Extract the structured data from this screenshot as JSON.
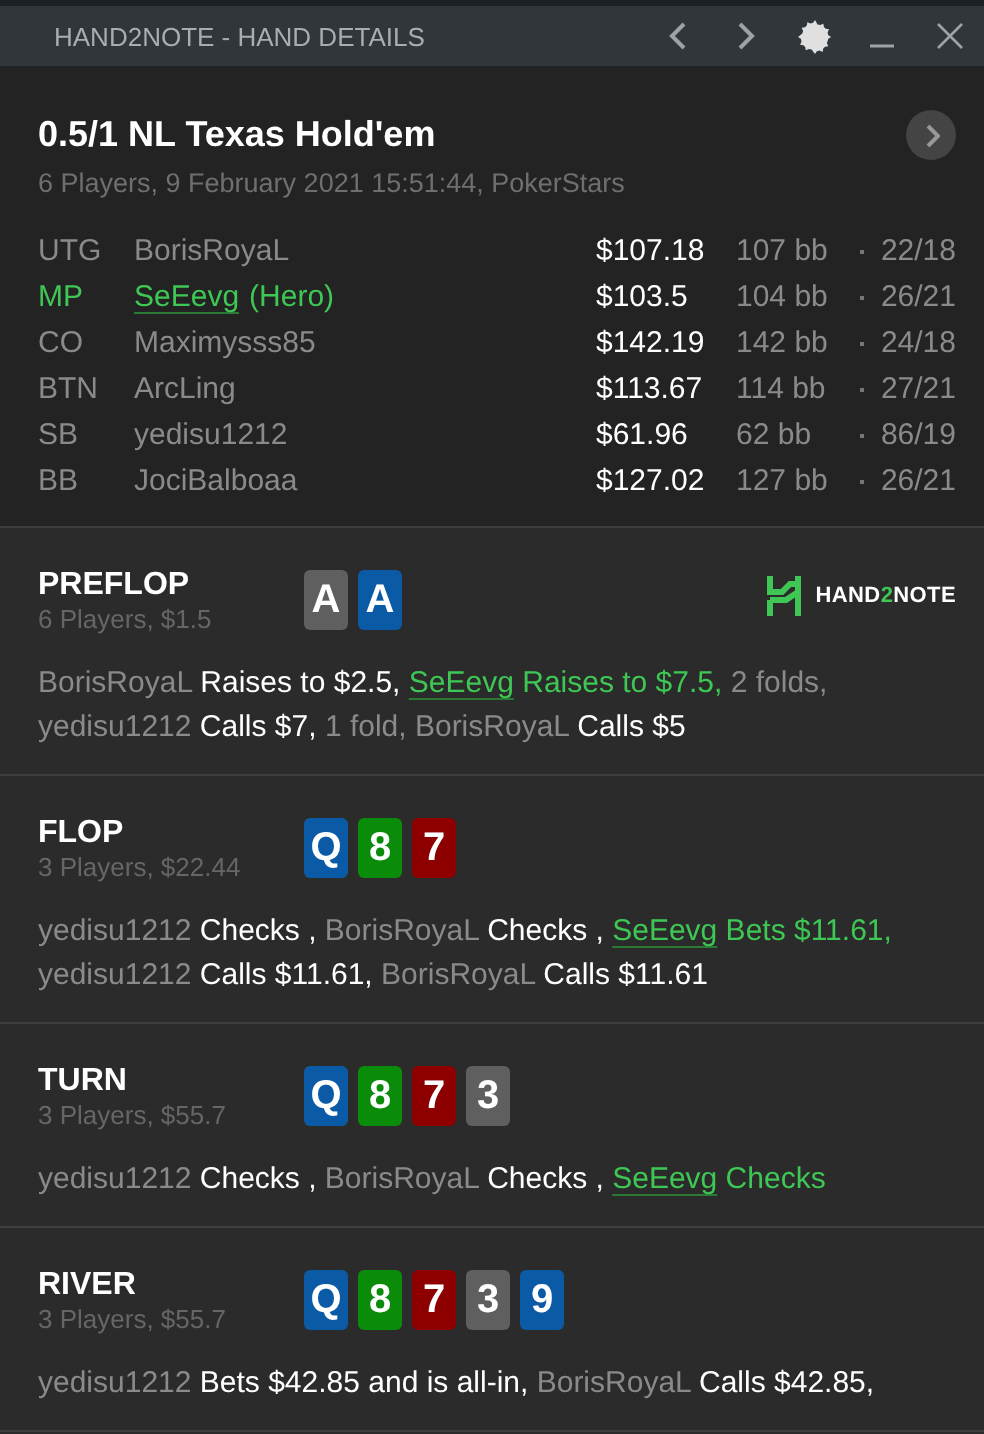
{
  "window": {
    "title": "HAND2NOTE - HAND DETAILS"
  },
  "hand": {
    "title": "0.5/1 NL Texas Hold'em",
    "subtitle": "6 Players, 9 February 2021 15:51:44, PokerStars"
  },
  "players": [
    {
      "position": "UTG",
      "name": "BorisRoyaL",
      "hero": false,
      "stack": "$107.18",
      "bb": "107 bb",
      "stats": "22/18"
    },
    {
      "position": "MP",
      "name": "SeEevg",
      "hero_tag": "(Hero)",
      "hero": true,
      "stack": "$103.5",
      "bb": "104 bb",
      "stats": "26/21"
    },
    {
      "position": "CO",
      "name": "Maximysss85",
      "hero": false,
      "stack": "$142.19",
      "bb": "142 bb",
      "stats": "24/18"
    },
    {
      "position": "BTN",
      "name": "ArcLing",
      "hero": false,
      "stack": "$113.67",
      "bb": "114 bb",
      "stats": "27/21"
    },
    {
      "position": "SB",
      "name": "yedisu1212",
      "hero": false,
      "stack": "$61.96",
      "bb": "62 bb",
      "stats": "86/19"
    },
    {
      "position": "BB",
      "name": "JociBalboaa",
      "hero": false,
      "stack": "$127.02",
      "bb": "127 bb",
      "stats": "26/21"
    }
  ],
  "logo": {
    "prefix": "HAND",
    "mid": "2",
    "suffix": "NOTE"
  },
  "streets": [
    {
      "name": "PREFLOP",
      "info": "6 Players, $1.5",
      "cards": [
        {
          "rank": "A",
          "color": "#5f5f5f"
        },
        {
          "rank": "A",
          "color": "#0b5aa6"
        }
      ],
      "actions": [
        {
          "kind": "player",
          "text": "BorisRoyaL"
        },
        {
          "kind": "action",
          "text": " Raises to $2.5, "
        },
        {
          "kind": "hero",
          "text": "SeEevg"
        },
        {
          "kind": "hero_action",
          "text": " Raises to $7.5, "
        },
        {
          "kind": "note",
          "text": "2 folds, "
        },
        {
          "kind": "player",
          "text": "yedisu1212"
        },
        {
          "kind": "action",
          "text": " Calls $7, "
        },
        {
          "kind": "note",
          "text": "1 fold, "
        },
        {
          "kind": "player",
          "text": "BorisRoyaL"
        },
        {
          "kind": "action",
          "text": " Calls $5"
        }
      ]
    },
    {
      "name": "FLOP",
      "info": "3 Players, $22.44",
      "cards": [
        {
          "rank": "Q",
          "color": "#0b5aa6"
        },
        {
          "rank": "8",
          "color": "#0a8c0a"
        },
        {
          "rank": "7",
          "color": "#8e0000"
        }
      ],
      "actions": [
        {
          "kind": "player",
          "text": "yedisu1212"
        },
        {
          "kind": "action",
          "text": " Checks , "
        },
        {
          "kind": "player",
          "text": "BorisRoyaL"
        },
        {
          "kind": "action",
          "text": " Checks , "
        },
        {
          "kind": "hero",
          "text": "SeEevg"
        },
        {
          "kind": "hero_action",
          "text": " Bets $11.61, "
        },
        {
          "kind": "player",
          "text": "yedisu1212"
        },
        {
          "kind": "action",
          "text": " Calls $11.61, "
        },
        {
          "kind": "player",
          "text": "BorisRoyaL"
        },
        {
          "kind": "action",
          "text": " Calls $11.61"
        }
      ]
    },
    {
      "name": "TURN",
      "info": "3 Players, $55.7",
      "cards": [
        {
          "rank": "Q",
          "color": "#0b5aa6"
        },
        {
          "rank": "8",
          "color": "#0a8c0a"
        },
        {
          "rank": "7",
          "color": "#8e0000"
        },
        {
          "rank": "3",
          "color": "#5f5f5f"
        }
      ],
      "actions": [
        {
          "kind": "player",
          "text": "yedisu1212"
        },
        {
          "kind": "action",
          "text": " Checks , "
        },
        {
          "kind": "player",
          "text": "BorisRoyaL"
        },
        {
          "kind": "action",
          "text": " Checks , "
        },
        {
          "kind": "hero",
          "text": "SeEevg"
        },
        {
          "kind": "hero_action",
          "text": " Checks"
        }
      ]
    },
    {
      "name": "RIVER",
      "info": "3 Players, $55.7",
      "cards": [
        {
          "rank": "Q",
          "color": "#0b5aa6"
        },
        {
          "rank": "8",
          "color": "#0a8c0a"
        },
        {
          "rank": "7",
          "color": "#8e0000"
        },
        {
          "rank": "3",
          "color": "#5f5f5f"
        },
        {
          "rank": "9",
          "color": "#0b5aa6"
        }
      ],
      "actions": [
        {
          "kind": "player",
          "text": "yedisu1212"
        },
        {
          "kind": "action",
          "text": " Bets $42.85 and is all-in, "
        },
        {
          "kind": "player",
          "text": "BorisRoyaL"
        },
        {
          "kind": "action",
          "text": " Calls $42.85,"
        }
      ]
    }
  ]
}
